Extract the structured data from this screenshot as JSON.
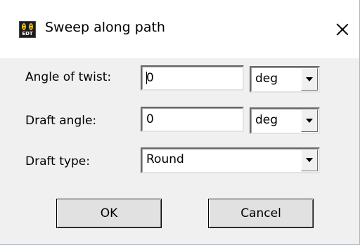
{
  "window": {
    "title": "Sweep along path",
    "icon": {
      "name": "edt-app-icon",
      "text": "EDT"
    },
    "close_icon": "close-icon"
  },
  "fields": {
    "angle_of_twist": {
      "label": "Angle of twist:",
      "value": "0",
      "unit": "deg"
    },
    "draft_angle": {
      "label": "Draft angle:",
      "value": "0",
      "unit": "deg"
    },
    "draft_type": {
      "label": "Draft type:",
      "value": "Round"
    }
  },
  "buttons": {
    "ok": "OK",
    "cancel": "Cancel"
  },
  "colors": {
    "dialog_bg": "#f0f0f0",
    "titlebar_bg": "#ffffff",
    "icon_bg": "#1c1c1c",
    "icon_accent": "#e8b820"
  }
}
